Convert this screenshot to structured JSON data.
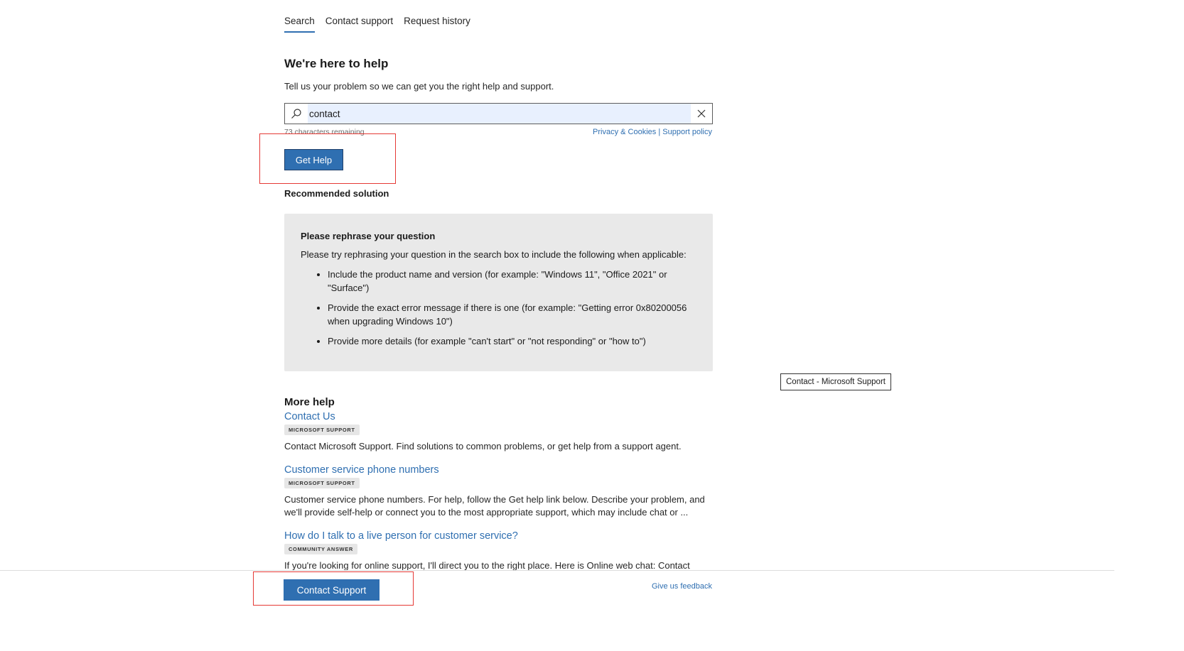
{
  "tabs": [
    {
      "label": "Search",
      "active": true
    },
    {
      "label": "Contact support",
      "active": false
    },
    {
      "label": "Request history",
      "active": false
    }
  ],
  "heading": "We're here to help",
  "subtext": "Tell us your problem so we can get you the right help and support.",
  "search": {
    "value": "contact",
    "chars_remaining": "73 characters remaining"
  },
  "links": {
    "privacy": "Privacy & Cookies",
    "separator": "|",
    "support_policy": "Support policy"
  },
  "get_help_label": "Get Help",
  "recommended_title": "Recommended solution",
  "rec_panel": {
    "title": "Please rephrase your question",
    "intro": "Please try rephrasing your question in the search box to include the following when applicable:",
    "bullets": [
      "Include the product name and version (for example: \"Windows 11\", \"Office 2021\" or \"Surface\")",
      "Provide the exact error message if there is one (for example: \"Getting error 0x80200056 when upgrading Windows 10\")",
      "Provide more details (for example \"can't start\" or \"not responding\" or \"how to\")"
    ]
  },
  "tooltip": "Contact - Microsoft Support",
  "more_help_title": "More help",
  "results": [
    {
      "title": "Contact Us",
      "badge": "MICROSOFT SUPPORT",
      "desc": "Contact Microsoft Support. Find solutions to common problems, or get help from a support agent."
    },
    {
      "title": "Customer service phone numbers",
      "badge": "MICROSOFT SUPPORT",
      "desc": "Customer service phone numbers. For help, follow the Get help link below. Describe your problem, and we'll provide self-help or connect you to the most appropriate support, which may include chat or ..."
    },
    {
      "title": "How do I talk to a live person for customer service?",
      "badge": "COMMUNITY ANSWER",
      "desc": "If you're looking for online support, I'll direct you to the right place. Here is Online web chat: Contact"
    }
  ],
  "footer": {
    "contact_support_label": "Contact Support",
    "feedback_label": "Give us feedback"
  },
  "colors": {
    "accent": "#2f6fb1",
    "panel_bg": "#e9e9e9",
    "highlight_red": "#e53935"
  }
}
